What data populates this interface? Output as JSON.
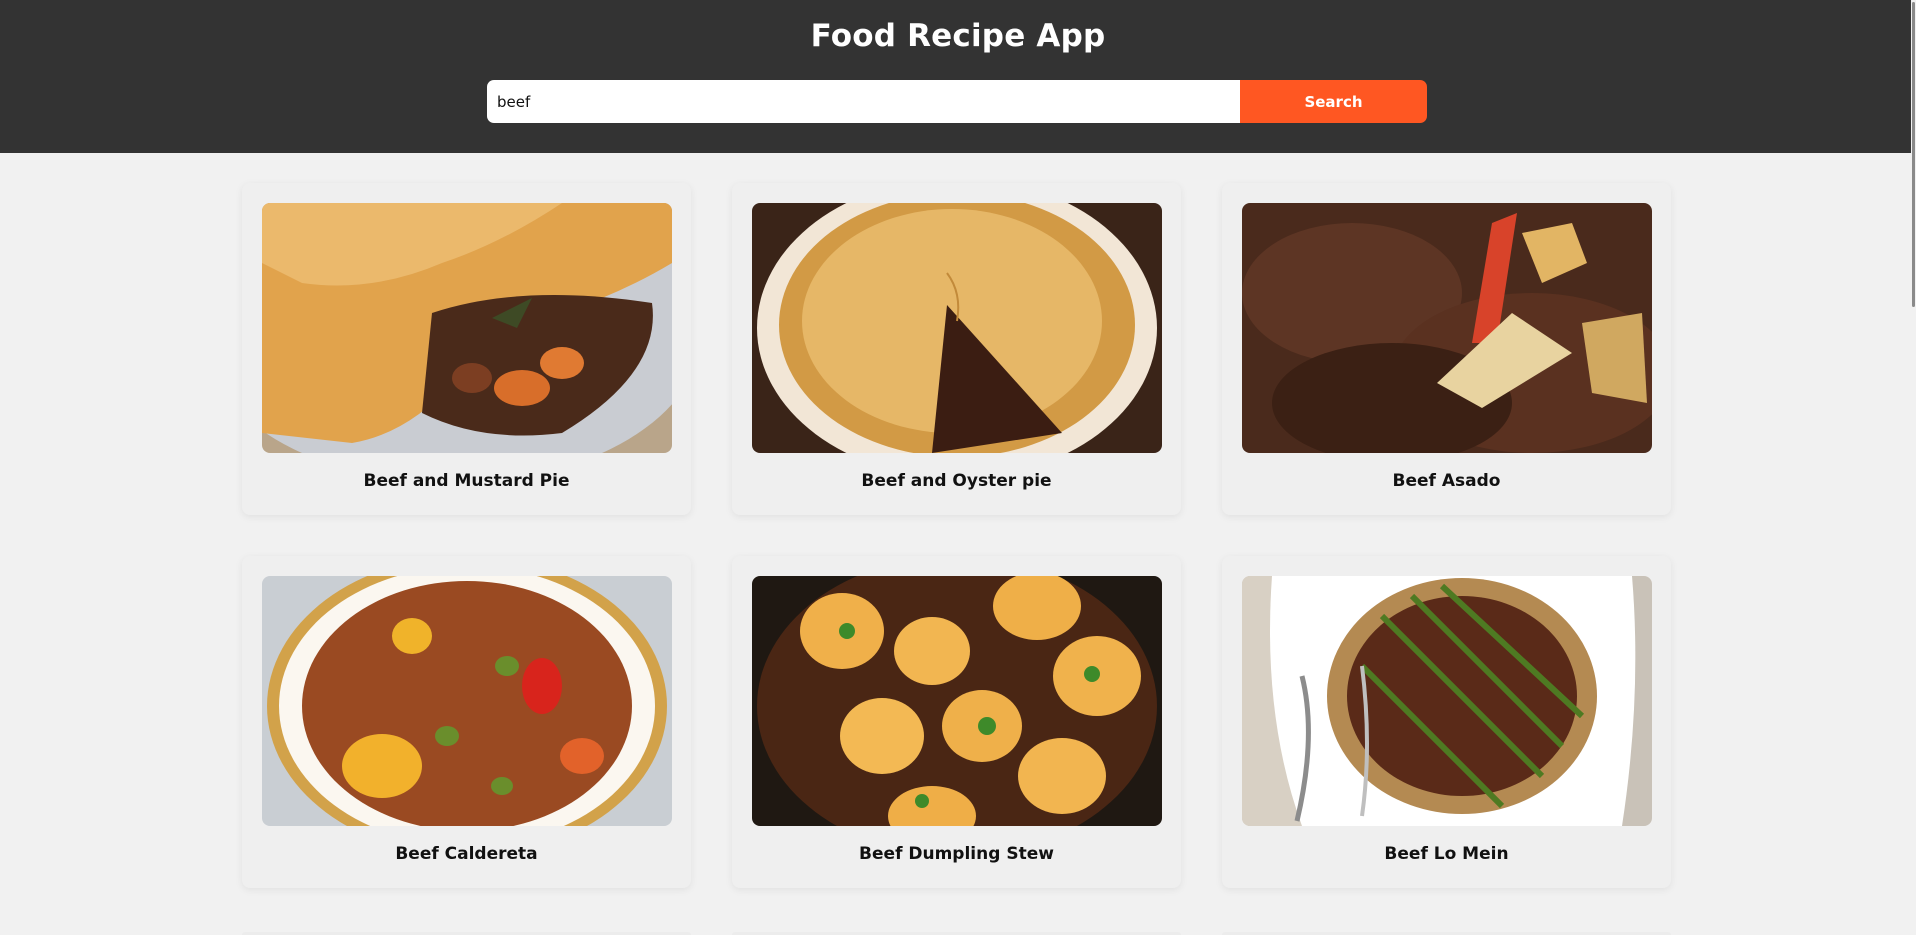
{
  "header": {
    "title": "Food Recipe App"
  },
  "search": {
    "value": "beef",
    "button_label": "Search"
  },
  "recipes": [
    {
      "title": "Beef and Mustard Pie",
      "image_icon": "pie-photo-icon"
    },
    {
      "title": "Beef and Oyster pie",
      "image_icon": "pie-photo-icon"
    },
    {
      "title": "Beef Asado",
      "image_icon": "stew-photo-icon"
    },
    {
      "title": "Beef Caldereta",
      "image_icon": "stew-photo-icon"
    },
    {
      "title": "Beef Dumpling Stew",
      "image_icon": "dumpling-stew-photo-icon"
    },
    {
      "title": "Beef Lo Mein",
      "image_icon": "noodles-photo-icon"
    }
  ],
  "colors": {
    "header_bg": "#333333",
    "accent": "#ff5722",
    "page_bg": "#f1f1f1",
    "card_bg": "#efefef"
  }
}
